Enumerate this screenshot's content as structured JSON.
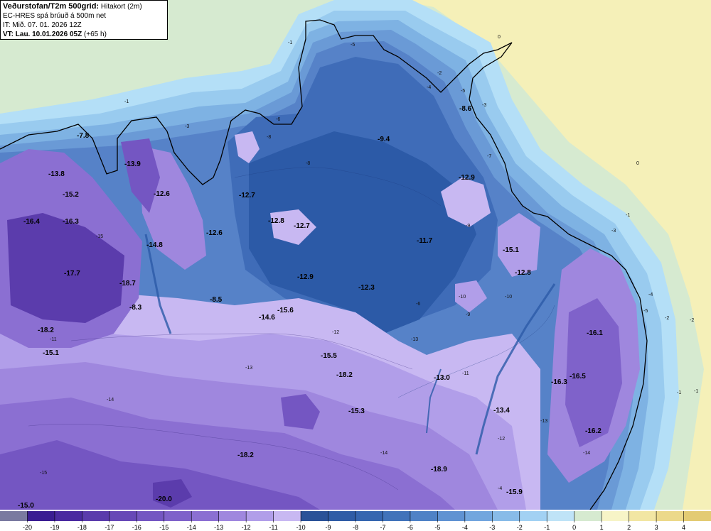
{
  "header": {
    "title": "Veðurstofan/T2m 500grid:",
    "subtitle": "Hitakort (2m)",
    "model": "EC-HRES spá brúuð á 500m net",
    "init_time": "IT: Mið. 07. 01. 2026 12Z",
    "valid_label": "VT: Lau. 10.01.2026 05Z",
    "lead_time": "(+65 h)"
  },
  "colors": {
    "sea_warm": "#f5f0b8",
    "sea_cool": "#d6ead0",
    "c_m1": "#b4dff7",
    "c_m2": "#99cbef",
    "c_m3": "#7eb2e3",
    "c_m4": "#6a9ad6",
    "c_m5": "#5682c8",
    "c_m7": "#3f6cb8",
    "c_m9": "#2c5aa7",
    "c_m11": "#c8b8f2",
    "c_m12": "#b19ee9",
    "c_m13": "#9f87de",
    "c_m14": "#8b6fd2",
    "c_m16": "#7456c2",
    "c_m18": "#5b3cac",
    "coast": "#000000"
  },
  "map_values": [
    {
      "text": "-7.8"
    },
    {
      "text": "-13.9"
    },
    {
      "text": "-13.8"
    },
    {
      "text": "-15.2"
    },
    {
      "text": "-16.4"
    },
    {
      "text": "-16.3"
    },
    {
      "text": "-12.6"
    },
    {
      "text": "-12.6"
    },
    {
      "text": "-17.7"
    },
    {
      "text": "-18.7"
    },
    {
      "text": "-14.8"
    },
    {
      "text": "-8.3"
    },
    {
      "text": "-8.5"
    },
    {
      "text": "-18.2"
    },
    {
      "text": "-15.1"
    },
    {
      "text": "-12.7"
    },
    {
      "text": "-12.8"
    },
    {
      "text": "-12.7"
    },
    {
      "text": "-9.4"
    },
    {
      "text": "-8.6"
    },
    {
      "text": "-12.9"
    },
    {
      "text": "-11.7"
    },
    {
      "text": "-12.9"
    },
    {
      "text": "-12.3"
    },
    {
      "text": "-15.6"
    },
    {
      "text": "-14.6"
    },
    {
      "text": "-15.1"
    },
    {
      "text": "-12.8"
    },
    {
      "text": "-15.5"
    },
    {
      "text": "-18.2"
    },
    {
      "text": "-13.0"
    },
    {
      "text": "-15.3"
    },
    {
      "text": "-13.4"
    },
    {
      "text": "-16.1"
    },
    {
      "text": "-16.5"
    },
    {
      "text": "-16.3"
    },
    {
      "text": "-16.2"
    },
    {
      "text": "-18.2"
    },
    {
      "text": "-18.9"
    },
    {
      "text": "-20.0"
    },
    {
      "text": "-15.9"
    },
    {
      "text": "-15.0"
    }
  ],
  "isolines": [
    {
      "text": "-1"
    },
    {
      "text": "-1"
    },
    {
      "text": "-2"
    },
    {
      "text": "-3"
    },
    {
      "text": "-3"
    },
    {
      "text": "-5"
    },
    {
      "text": "-5"
    },
    {
      "text": "-4"
    },
    {
      "text": "-2"
    },
    {
      "text": "-1"
    },
    {
      "text": "0"
    },
    {
      "text": "0"
    },
    {
      "text": "-1"
    },
    {
      "text": "-3"
    },
    {
      "text": "-4"
    },
    {
      "text": "-5"
    },
    {
      "text": "-2"
    },
    {
      "text": "-1"
    },
    {
      "text": "-8"
    },
    {
      "text": "-8"
    },
    {
      "text": "-10"
    },
    {
      "text": "-12"
    },
    {
      "text": "-13"
    },
    {
      "text": "-14"
    },
    {
      "text": "-15"
    },
    {
      "text": "-11"
    },
    {
      "text": "-9"
    },
    {
      "text": "-6"
    },
    {
      "text": "-7"
    },
    {
      "text": "-12"
    },
    {
      "text": "-13"
    },
    {
      "text": "-14"
    },
    {
      "text": "-10"
    },
    {
      "text": "-11"
    },
    {
      "text": "-9"
    },
    {
      "text": "-14"
    },
    {
      "text": "-13"
    },
    {
      "text": "-15"
    },
    {
      "text": "-6"
    },
    {
      "text": "-4"
    }
  ],
  "legend": {
    "ticks": [
      "-20",
      "-19",
      "-18",
      "-17",
      "-16",
      "-15",
      "-14",
      "-13",
      "-12",
      "-11",
      "-10",
      "-9",
      "-8",
      "-7",
      "-6",
      "-5",
      "-4",
      "-3",
      "-2",
      "-1",
      "0",
      "1",
      "2",
      "3",
      "4"
    ],
    "colors": [
      "#7a7aa0",
      "#3a1d92",
      "#4a2aa0",
      "#5b3cac",
      "#6748b7",
      "#7456c2",
      "#7f62ca",
      "#8b6fd2",
      "#9f87de",
      "#b19ee9",
      "#c8b8f2",
      "#2a5298",
      "#2f5ca6",
      "#3666b0",
      "#4173ba",
      "#4f82c6",
      "#5f92d2",
      "#72a6de",
      "#88bbe8",
      "#a2d1f3",
      "#bfe3f7",
      "#d6ead0",
      "#f7f4c7",
      "#f2e6a3",
      "#ecd98a",
      "#e3cb73"
    ]
  }
}
